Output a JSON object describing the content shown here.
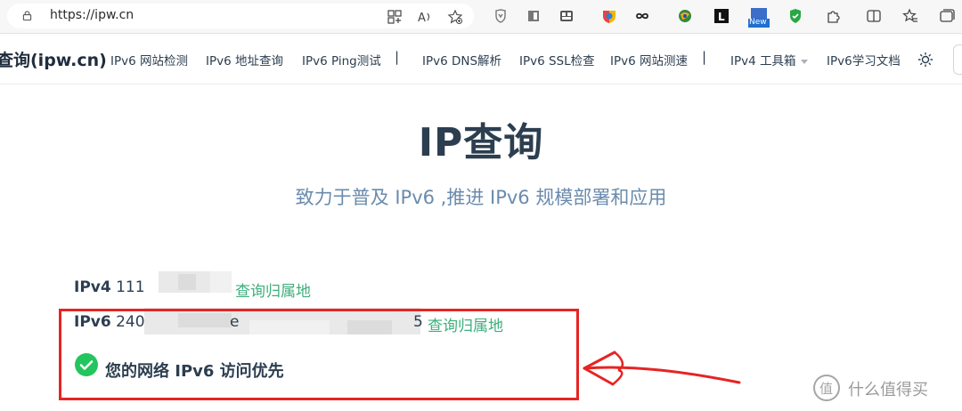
{
  "browser": {
    "url": "https://ipw.cn",
    "extensions": [
      "reader-mode-icon",
      "read-aloud-icon",
      "favorite-add-icon",
      "shield-extension-icon",
      "reader-extension-icon",
      "grid-extension-icon",
      "colorful-extension-icon",
      "infinity-extension-icon",
      "globe-extension-icon",
      "L-extension-icon",
      "new-extension-icon",
      "green-shield-icon",
      "puzzle-extensions-icon",
      "split-screen-icon",
      "favorites-icon",
      "collections-icon"
    ],
    "new_badge": "New"
  },
  "nav": {
    "brand": "查询(ipw.cn)",
    "links": [
      {
        "label": "IPv6 网站检测"
      },
      {
        "label": "IPv6 地址查询"
      },
      {
        "label": "IPv6 Ping测试"
      },
      {
        "label": "IPv6 DNS解析"
      },
      {
        "label": "IPv6 SSL检查"
      },
      {
        "label": "IPv6 网站测速"
      },
      {
        "label": "IPv4 工具箱"
      },
      {
        "label": "IPv6学习文档"
      }
    ],
    "separator": "|"
  },
  "hero": {
    "title": "IP查询",
    "subtitle": "致力于普及 IPv6 ,推进 IPv6 规模部署和应用"
  },
  "results": {
    "ipv4": {
      "label": "IPv4",
      "value_prefix": "111",
      "link": "查询归属地"
    },
    "ipv6": {
      "label": "IPv6",
      "value_prefix": "240",
      "value_mid": "e",
      "value_end": "5",
      "link": "查询归属地"
    },
    "preferred_message": "您的网络 IPv6 访问优先"
  },
  "colors": {
    "accent_green": "#3eaf7c",
    "highlight_red": "#e62424",
    "title": "#2c3e50",
    "subtitle": "#6a8bad"
  },
  "watermark": {
    "text": "什么值得买",
    "icon": "zhi-logo-icon"
  }
}
